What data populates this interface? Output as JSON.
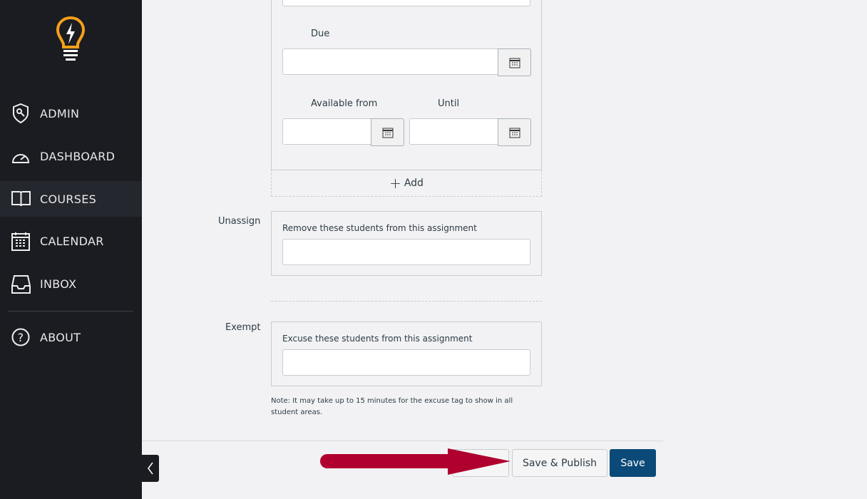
{
  "sidebar": {
    "items": [
      {
        "label": "ADMIN",
        "icon": "shield-key-icon"
      },
      {
        "label": "DASHBOARD",
        "icon": "speedometer-icon"
      },
      {
        "label": "COURSES",
        "icon": "book-icon",
        "active": true
      },
      {
        "label": "CALENDAR",
        "icon": "calendar-icon"
      },
      {
        "label": "INBOX",
        "icon": "inbox-icon"
      },
      {
        "label": "ABOUT",
        "icon": "question-circle-icon"
      }
    ]
  },
  "assign": {
    "due_label": "Due",
    "available_from_label": "Available from",
    "until_label": "Until",
    "add_label": "Add"
  },
  "unassign": {
    "label": "Unassign",
    "hint": "Remove these students from this assignment"
  },
  "exempt": {
    "label": "Exempt",
    "hint": "Excuse these students from this assignment",
    "note": "Note: It may take up to 15 minutes for the excuse tag to show in all student areas."
  },
  "footer": {
    "save_publish_label": "Save & Publish",
    "save_label": "Save"
  },
  "colors": {
    "accent": "#0b4a78",
    "arrow": "#b0002f",
    "logo": "#f5a01a"
  }
}
